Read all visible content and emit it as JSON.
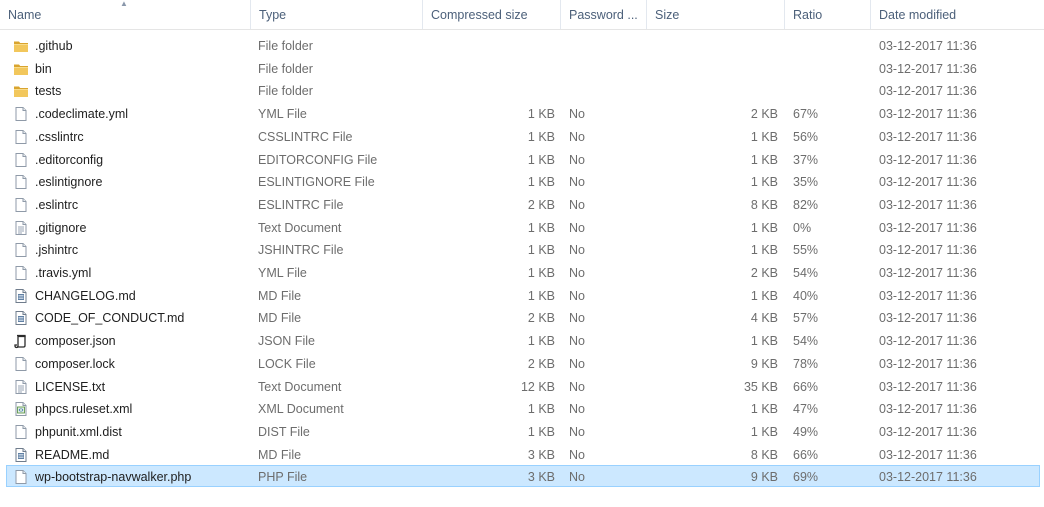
{
  "header": {
    "name": "Name",
    "type": "Type",
    "compressed_size": "Compressed size",
    "password": "Password ...",
    "size": "Size",
    "ratio": "Ratio",
    "date_modified": "Date modified",
    "sort_indicator": "▲"
  },
  "colors": {
    "selected_bg": "#cce8ff",
    "selected_border": "#99d1ff",
    "header_text": "#4c607a",
    "detail_text": "#6d6d6d",
    "folder": "#e8b84a"
  },
  "files": [
    {
      "name": ".github",
      "icon": "folder-icon",
      "type": "File folder",
      "compressed": "",
      "password": "",
      "size": "",
      "ratio": "",
      "date": "03-12-2017 11:36"
    },
    {
      "name": "bin",
      "icon": "folder-icon",
      "type": "File folder",
      "compressed": "",
      "password": "",
      "size": "",
      "ratio": "",
      "date": "03-12-2017 11:36"
    },
    {
      "name": "tests",
      "icon": "folder-icon",
      "type": "File folder",
      "compressed": "",
      "password": "",
      "size": "",
      "ratio": "",
      "date": "03-12-2017 11:36"
    },
    {
      "name": ".codeclimate.yml",
      "icon": "blank-file-icon",
      "type": "YML File",
      "compressed": "1 KB",
      "password": "No",
      "size": "2 KB",
      "ratio": "67%",
      "date": "03-12-2017 11:36"
    },
    {
      "name": ".csslintrc",
      "icon": "blank-file-icon",
      "type": "CSSLINTRC File",
      "compressed": "1 KB",
      "password": "No",
      "size": "1 KB",
      "ratio": "56%",
      "date": "03-12-2017 11:36"
    },
    {
      "name": ".editorconfig",
      "icon": "blank-file-icon",
      "type": "EDITORCONFIG File",
      "compressed": "1 KB",
      "password": "No",
      "size": "1 KB",
      "ratio": "37%",
      "date": "03-12-2017 11:36"
    },
    {
      "name": ".eslintignore",
      "icon": "blank-file-icon",
      "type": "ESLINTIGNORE File",
      "compressed": "1 KB",
      "password": "No",
      "size": "1 KB",
      "ratio": "35%",
      "date": "03-12-2017 11:36"
    },
    {
      "name": ".eslintrc",
      "icon": "blank-file-icon",
      "type": "ESLINTRC File",
      "compressed": "2 KB",
      "password": "No",
      "size": "8 KB",
      "ratio": "82%",
      "date": "03-12-2017 11:36"
    },
    {
      "name": ".gitignore",
      "icon": "text-file-icon",
      "type": "Text Document",
      "compressed": "1 KB",
      "password": "No",
      "size": "1 KB",
      "ratio": "0%",
      "date": "03-12-2017 11:36"
    },
    {
      "name": ".jshintrc",
      "icon": "blank-file-icon",
      "type": "JSHINTRC File",
      "compressed": "1 KB",
      "password": "No",
      "size": "1 KB",
      "ratio": "55%",
      "date": "03-12-2017 11:36"
    },
    {
      "name": ".travis.yml",
      "icon": "blank-file-icon",
      "type": "YML File",
      "compressed": "1 KB",
      "password": "No",
      "size": "2 KB",
      "ratio": "54%",
      "date": "03-12-2017 11:36"
    },
    {
      "name": "CHANGELOG.md",
      "icon": "md-file-icon",
      "type": "MD File",
      "compressed": "1 KB",
      "password": "No",
      "size": "1 KB",
      "ratio": "40%",
      "date": "03-12-2017 11:36"
    },
    {
      "name": "CODE_OF_CONDUCT.md",
      "icon": "md-file-icon",
      "type": "MD File",
      "compressed": "2 KB",
      "password": "No",
      "size": "4 KB",
      "ratio": "57%",
      "date": "03-12-2017 11:36"
    },
    {
      "name": "composer.json",
      "icon": "json-file-icon",
      "type": "JSON File",
      "compressed": "1 KB",
      "password": "No",
      "size": "1 KB",
      "ratio": "54%",
      "date": "03-12-2017 11:36"
    },
    {
      "name": "composer.lock",
      "icon": "blank-file-icon",
      "type": "LOCK File",
      "compressed": "2 KB",
      "password": "No",
      "size": "9 KB",
      "ratio": "78%",
      "date": "03-12-2017 11:36"
    },
    {
      "name": "LICENSE.txt",
      "icon": "text-file-icon",
      "type": "Text Document",
      "compressed": "12 KB",
      "password": "No",
      "size": "35 KB",
      "ratio": "66%",
      "date": "03-12-2017 11:36"
    },
    {
      "name": "phpcs.ruleset.xml",
      "icon": "xml-file-icon",
      "type": "XML Document",
      "compressed": "1 KB",
      "password": "No",
      "size": "1 KB",
      "ratio": "47%",
      "date": "03-12-2017 11:36"
    },
    {
      "name": "phpunit.xml.dist",
      "icon": "blank-file-icon",
      "type": "DIST File",
      "compressed": "1 KB",
      "password": "No",
      "size": "1 KB",
      "ratio": "49%",
      "date": "03-12-2017 11:36"
    },
    {
      "name": "README.md",
      "icon": "md-file-icon",
      "type": "MD File",
      "compressed": "3 KB",
      "password": "No",
      "size": "8 KB",
      "ratio": "66%",
      "date": "03-12-2017 11:36"
    },
    {
      "name": "wp-bootstrap-navwalker.php",
      "icon": "blank-file-icon",
      "type": "PHP File",
      "compressed": "3 KB",
      "password": "No",
      "size": "9 KB",
      "ratio": "69%",
      "date": "03-12-2017 11:36",
      "selected": true
    }
  ]
}
